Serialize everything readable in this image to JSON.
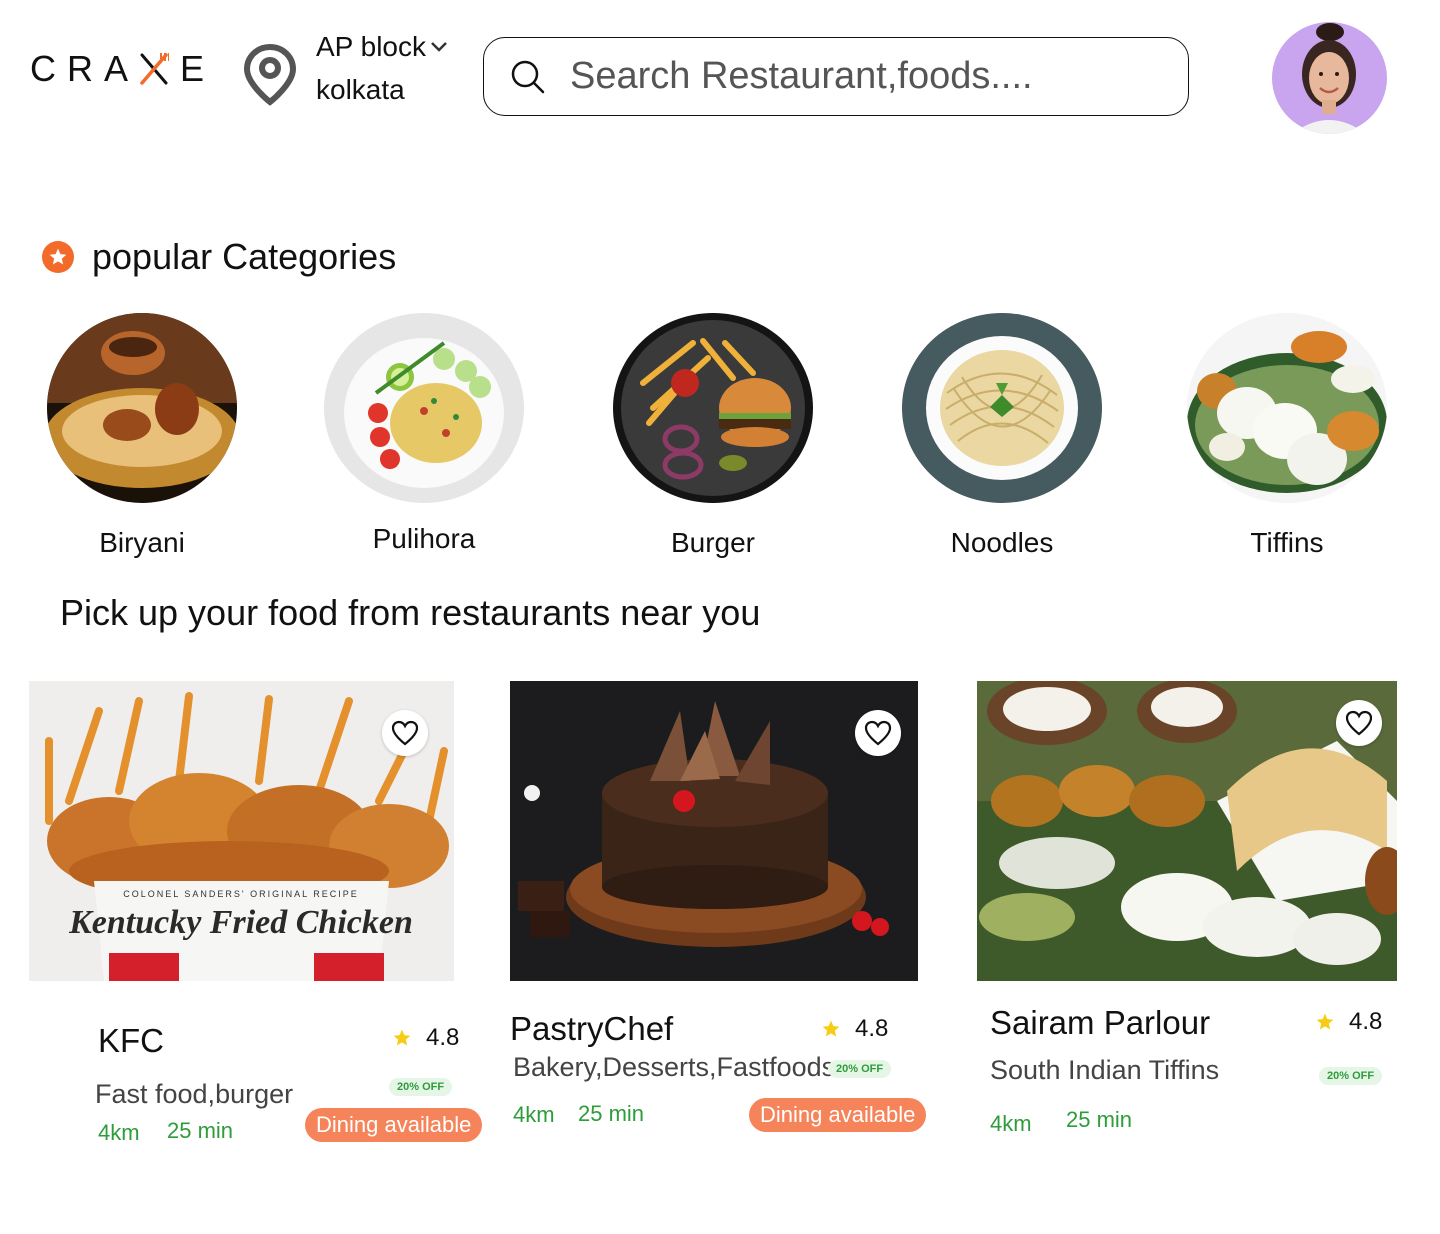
{
  "header": {
    "logo": "CRA E",
    "location_line1": "AP block",
    "location_line2": "kolkata",
    "search_placeholder": "Search Restaurant,foods...."
  },
  "categories_section": {
    "title": "popular Categories",
    "items": [
      {
        "label": "Biryani"
      },
      {
        "label": "Pulihora"
      },
      {
        "label": "Burger"
      },
      {
        "label": "Noodles"
      },
      {
        "label": "Tiffins"
      }
    ]
  },
  "restaurants_section": {
    "title": "Pick up your food from restaurants near you",
    "items": [
      {
        "name": "KFC",
        "rating": "4.8",
        "description": "Fast food,burger",
        "offer": "20% OFF",
        "distance": "4km",
        "time": "25 min",
        "dining": "Dining available",
        "image_text": "Kentucky Fried Chicken",
        "image_subtext": "COLONEL SANDERS' ORIGINAL RECIPE"
      },
      {
        "name": "PastryChef",
        "rating": "4.8",
        "description": "Bakery,Desserts,Fastfoods",
        "offer": "20% OFF",
        "distance": "4km",
        "time": "25 min",
        "dining": "Dining available"
      },
      {
        "name": "Sairam Parlour",
        "rating": "4.8",
        "description": "South Indian Tiffins",
        "offer": "20% OFF",
        "distance": "4km",
        "time": "25 min"
      }
    ]
  },
  "colors": {
    "accent_orange": "#f26b2a",
    "dining_badge": "#f5845a",
    "green_text": "#2e9c3a",
    "star_yellow": "#f7cc14",
    "avatar_bg": "#c9a4ef"
  },
  "icons": [
    "location-pin-icon",
    "chevron-down-icon",
    "search-icon",
    "star-icon",
    "heart-icon",
    "fork-knife-icon"
  ]
}
